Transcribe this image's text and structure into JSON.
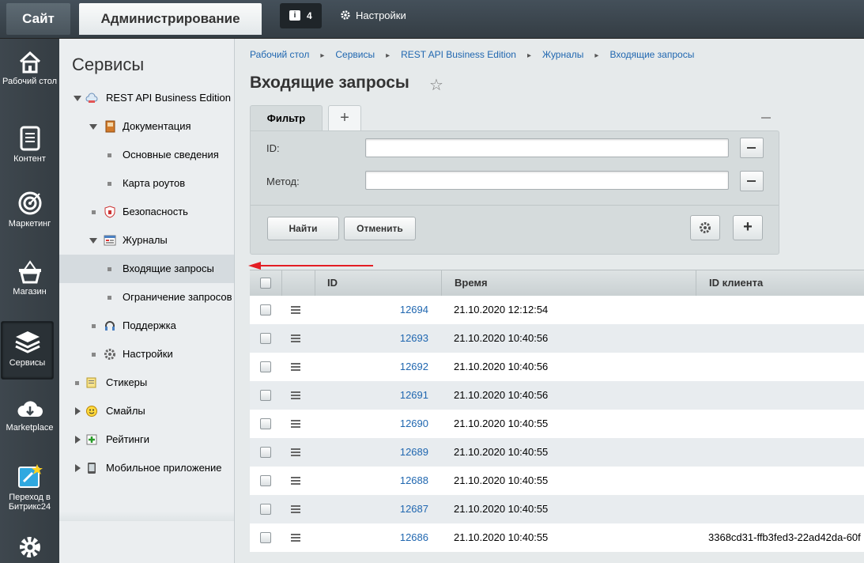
{
  "topbar": {
    "site_tab": "Сайт",
    "admin_tab": "Администрирование",
    "notifications_count": "4",
    "settings_label": "Настройки"
  },
  "iconpanel": {
    "items": [
      {
        "label": "Рабочий стол",
        "icon": "home-icon"
      },
      {
        "label": "Контент",
        "icon": "document-icon"
      },
      {
        "label": "Маркетинг",
        "icon": "target-icon"
      },
      {
        "label": "Магазин",
        "icon": "basket-icon"
      },
      {
        "label": "Сервисы",
        "icon": "layers-icon"
      },
      {
        "label": "Marketplace",
        "icon": "cloud-download-icon"
      },
      {
        "label": "Переход в Битрикс24",
        "icon": "bitrix24-icon"
      },
      {
        "label": "",
        "icon": "gear-icon"
      }
    ]
  },
  "tree": {
    "title": "Сервисы",
    "items": [
      {
        "label": "REST API Business Edition"
      },
      {
        "label": "Документация"
      },
      {
        "label": "Основные сведения"
      },
      {
        "label": "Карта роутов"
      },
      {
        "label": "Безопасность"
      },
      {
        "label": "Журналы"
      },
      {
        "label": "Входящие запросы"
      },
      {
        "label": "Ограничение запросов"
      },
      {
        "label": "Поддержка"
      },
      {
        "label": "Настройки"
      },
      {
        "label": "Стикеры"
      },
      {
        "label": "Смайлы"
      },
      {
        "label": "Рейтинги"
      },
      {
        "label": "Мобильное приложение"
      }
    ]
  },
  "breadcrumb": [
    "Рабочий стол",
    "Сервисы",
    "REST API Business Edition",
    "Журналы",
    "Входящие запросы"
  ],
  "page": {
    "title": "Входящие запросы"
  },
  "filter": {
    "tab_label": "Фильтр",
    "add_tab": "+",
    "fields": [
      {
        "label": "ID:",
        "value": ""
      },
      {
        "label": "Метод:",
        "value": ""
      }
    ],
    "find_button": "Найти",
    "cancel_button": "Отменить",
    "add_button": "+"
  },
  "grid": {
    "columns": [
      "ID",
      "Время",
      "ID клиента"
    ],
    "rows": [
      {
        "id": "12694",
        "time": "21.10.2020 12:12:54",
        "client": ""
      },
      {
        "id": "12693",
        "time": "21.10.2020 10:40:56",
        "client": ""
      },
      {
        "id": "12692",
        "time": "21.10.2020 10:40:56",
        "client": ""
      },
      {
        "id": "12691",
        "time": "21.10.2020 10:40:56",
        "client": ""
      },
      {
        "id": "12690",
        "time": "21.10.2020 10:40:55",
        "client": ""
      },
      {
        "id": "12689",
        "time": "21.10.2020 10:40:55",
        "client": ""
      },
      {
        "id": "12688",
        "time": "21.10.2020 10:40:55",
        "client": ""
      },
      {
        "id": "12687",
        "time": "21.10.2020 10:40:55",
        "client": ""
      },
      {
        "id": "12686",
        "time": "21.10.2020 10:40:55",
        "client": "3368cd31-ffb3fed3-22ad42da-60f"
      }
    ]
  },
  "colors": {
    "topbar": "#3b454c",
    "link": "#2067b0",
    "annotation_arrow": "#e31e24"
  }
}
